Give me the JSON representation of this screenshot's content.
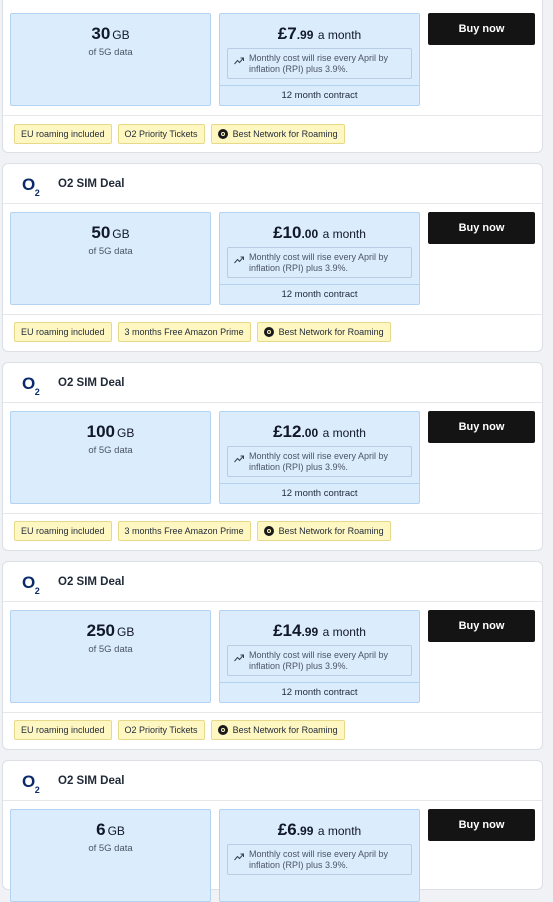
{
  "common": {
    "buy_label": "Buy now",
    "data_caption": "of 5G data",
    "period": "a month",
    "rpi_notice": "Monthly cost will rise every April by inflation (RPI) plus 3.9%.",
    "contract": "12 month contract",
    "data_unit": "GB"
  },
  "deals": [
    {
      "provider_logo": "O",
      "provider_logo_sub": "2",
      "title": "O2 SIM Deal",
      "data_amount": "30",
      "price_pounds": "£7",
      "price_pence": ".99",
      "tags": [
        "EU roaming included",
        "O2 Priority Tickets",
        "Best Network for Roaming"
      ]
    },
    {
      "provider_logo": "O",
      "provider_logo_sub": "2",
      "title": "O2 SIM Deal",
      "data_amount": "50",
      "price_pounds": "£10",
      "price_pence": ".00",
      "tags": [
        "EU roaming included",
        "3 months Free Amazon Prime",
        "Best Network for Roaming"
      ]
    },
    {
      "provider_logo": "O",
      "provider_logo_sub": "2",
      "title": "O2 SIM Deal",
      "data_amount": "100",
      "price_pounds": "£12",
      "price_pence": ".00",
      "tags": [
        "EU roaming included",
        "3 months Free Amazon Prime",
        "Best Network for Roaming"
      ]
    },
    {
      "provider_logo": "O",
      "provider_logo_sub": "2",
      "title": "O2 SIM Deal",
      "data_amount": "250",
      "price_pounds": "£14",
      "price_pence": ".99",
      "tags": [
        "EU roaming included",
        "O2 Priority Tickets",
        "Best Network for Roaming"
      ]
    },
    {
      "provider_logo": "O",
      "provider_logo_sub": "2",
      "title": "O2 SIM Deal",
      "data_amount": "6",
      "price_pounds": "£6",
      "price_pence": ".99",
      "tags": []
    }
  ],
  "icons": {
    "trend": "trend-up-icon",
    "award": "award-badge-icon"
  }
}
